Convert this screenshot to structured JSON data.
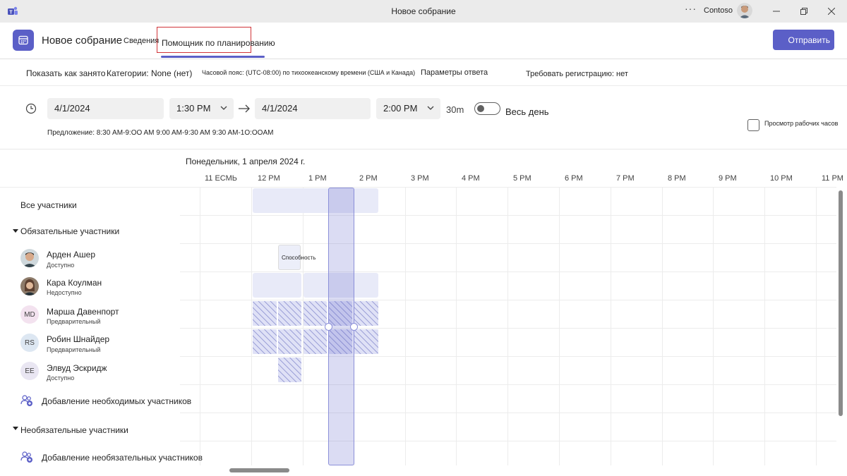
{
  "window": {
    "title": "Новое собрание",
    "org": "Contoso",
    "more_glyph": "···",
    "icons": [
      "teams-logo-icon",
      "minimize-icon",
      "maximize-icon",
      "close-icon"
    ]
  },
  "header": {
    "title": "Новое собрание",
    "tabs": [
      {
        "label": "Сведения",
        "active": false
      },
      {
        "label": "Помощник по планированию",
        "active": true
      }
    ],
    "send_label": "Отправить",
    "accent_color": "#5b5fc7",
    "highlight_color": "#d13438"
  },
  "options": {
    "show_as": "Показать как занято",
    "categories": "Категории: None (нет)",
    "timezone": "Часовой пояс: (UTC-08:00) по тихоокеанскому времени (США и Канада)",
    "response": "Параметры ответа",
    "registration": "Требовать регистрацию: нет"
  },
  "time": {
    "start_date": "4/1/2024",
    "start_time": "1:30 PM",
    "end_date": "4/1/2024",
    "end_time": "2:00 PM",
    "duration": "30m",
    "all_day_label": "Весь день",
    "all_day_on": false,
    "suggestions": "Предложение: 8:30 AM-9:OO AM 9:00 AM-9:30 AM 9:30 AM-1O:OOAM",
    "working_hours_label": "Просмотр рабочих часов"
  },
  "schedule": {
    "date_label": "Понедельник, 1 апреля 2024 г.",
    "hours": [
      "11 ЕСМЬ",
      "12 PM",
      "1 PM",
      "2 PM",
      "3 PM",
      "4 PM",
      "5 PM",
      "6 PM",
      "7 PM",
      "8 PM",
      "9 PM",
      "10 PM",
      "11 PM"
    ],
    "capacity_label": "Способность"
  },
  "attendees": {
    "all_label": "Все участники",
    "required_label": "Обязательные участники",
    "optional_label": "Необязательные участники",
    "add_required_label": "Добавление необходимых участников",
    "add_optional_label": "Добавление необязательных участников",
    "people": [
      {
        "name": "Арден Ашер",
        "status": "Доступно",
        "initials": ""
      },
      {
        "name": "Кара Коулман",
        "status": "Недоступно",
        "initials": ""
      },
      {
        "name": "Марша Давенпорт",
        "status": "Предварительный",
        "initials": "MD"
      },
      {
        "name": "Робин Шнайдер",
        "status": "Предварительный",
        "initials": "RS"
      },
      {
        "name": "Элвуд Эскридж",
        "status": "Доступно",
        "initials": "EE"
      }
    ]
  }
}
